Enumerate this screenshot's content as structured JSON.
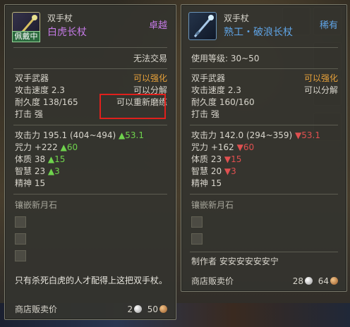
{
  "left_tooltip": {
    "equipped_tag": "佩戴中",
    "item_type": "双手杖",
    "item_name": "白虎长杖",
    "rarity": "卓越",
    "trade": "无法交易",
    "weapon_class": "双手武器",
    "enhance": "可以强化",
    "attack_speed": "攻击速度 2.3",
    "disassemble": "可以分解",
    "durability": "耐久度 138/165",
    "regrind": "可以重新磨练",
    "strike": "打击 强",
    "attack_power": "攻击力 195.1 (404~494)",
    "attack_power_delta": "▲53.1",
    "spell_power": "咒力 +222",
    "spell_power_delta": "▲60",
    "constitution": "体质 38",
    "constitution_delta": "▲15",
    "wisdom": "智慧 23",
    "wisdom_delta": "▲3",
    "spirit": "精神 15",
    "socket_label": "镶嵌新月石",
    "description": "只有杀死白虎的人才配得上这把双手杖。",
    "shop_price_label": "商店贩卖价",
    "price_silver": "2",
    "price_copper": "50"
  },
  "right_tooltip": {
    "item_type": "双手杖",
    "item_name": "熟工・破浪长杖",
    "rarity": "稀有",
    "level_req": "使用等级: 30~50",
    "weapon_class": "双手武器",
    "enhance": "可以强化",
    "attack_speed": "攻击速度 2.3",
    "disassemble": "可以分解",
    "durability": "耐久度 160/160",
    "strike": "打击 强",
    "attack_power": "攻击力 142.0 (294~359)",
    "attack_power_delta": "▼53.1",
    "spell_power": "咒力 +162",
    "spell_power_delta": "▼60",
    "constitution": "体质 23",
    "constitution_delta": "▼15",
    "wisdom": "智慧 20",
    "wisdom_delta": "▼3",
    "spirit": "精神 15",
    "socket_label": "镶嵌新月石",
    "maker": "制作者 安安安安安安宁",
    "shop_price_label": "商店贩卖价",
    "price_silver": "28",
    "price_copper": "64"
  },
  "colors": {
    "purple": "#c57ae6",
    "blue": "#5fa4e6",
    "orange": "#e8a23a",
    "green": "#6fd34d",
    "red": "#e05050",
    "highlight": "#e0201c"
  },
  "icons": [
    "staff-icon",
    "silver-coin-icon",
    "copper-coin-icon"
  ]
}
